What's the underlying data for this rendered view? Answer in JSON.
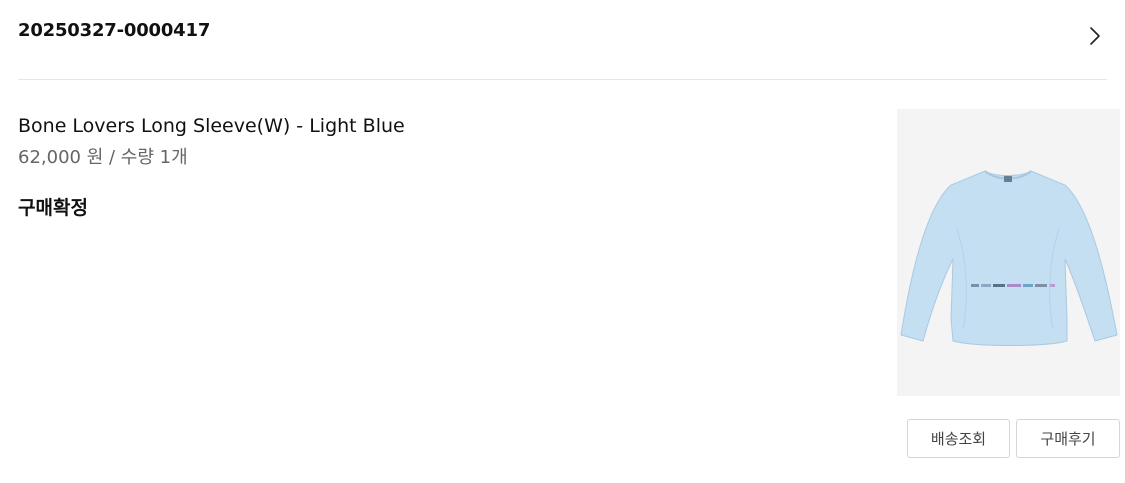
{
  "order": {
    "number": "20250327-0000417"
  },
  "product": {
    "name": "Bone Lovers Long Sleeve(W) - Light Blue",
    "price_quantity": "62,000 원 / 수량 1개",
    "status": "구매확정",
    "image_icon": "long-sleeve-shirt-image",
    "shirt_color": "#c4def2"
  },
  "actions": {
    "track_label": "배송조회",
    "review_label": "구매후기"
  },
  "icons": {
    "detail": "chevron-right-icon"
  }
}
